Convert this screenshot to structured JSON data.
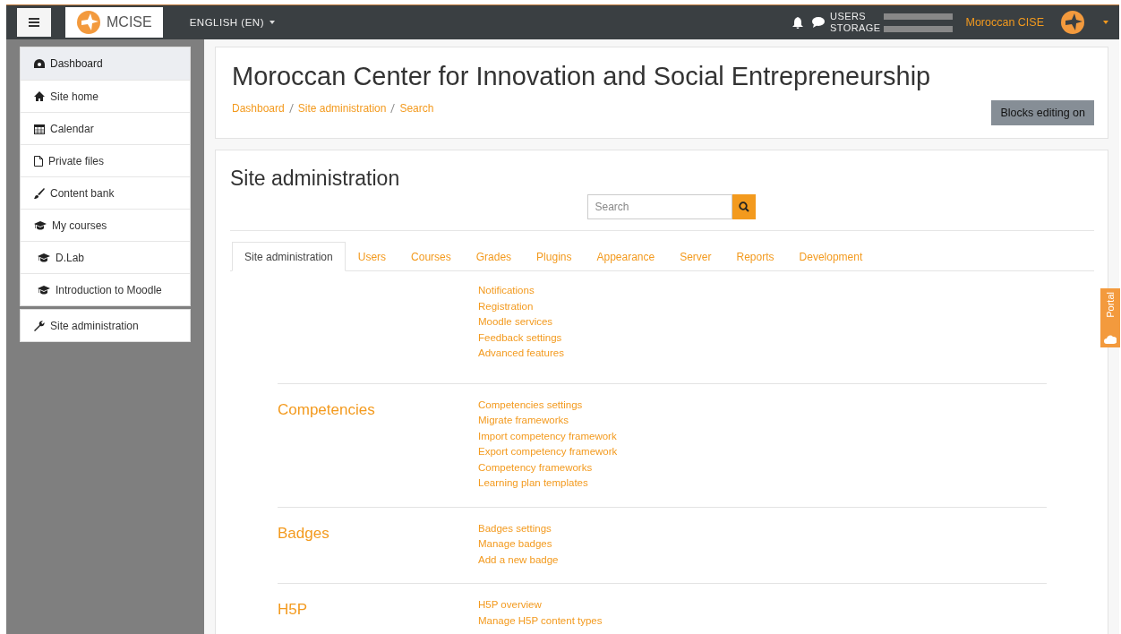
{
  "navbar": {
    "brand": "MCISE",
    "language": "ENGLISH (EN)",
    "usage_labels": [
      "USERS",
      "STORAGE"
    ],
    "user_name": "Moroccan CISE"
  },
  "sidebar": {
    "items": [
      {
        "label": "Dashboard",
        "kind": "dashboard",
        "selected": true,
        "nested": false
      },
      {
        "label": "Site home",
        "kind": "home",
        "selected": false,
        "nested": false
      },
      {
        "label": "Calendar",
        "kind": "calendar",
        "selected": false,
        "nested": false
      },
      {
        "label": "Private files",
        "kind": "file",
        "selected": false,
        "nested": false
      },
      {
        "label": "Content bank",
        "kind": "bank",
        "selected": false,
        "nested": false
      },
      {
        "label": "My courses",
        "kind": "courses",
        "selected": false,
        "nested": false
      },
      {
        "label": "D.Lab",
        "kind": "course",
        "selected": false,
        "nested": true
      },
      {
        "label": "Introduction to Moodle",
        "kind": "course",
        "selected": false,
        "nested": true
      }
    ],
    "admin_item": {
      "label": "Site administration"
    }
  },
  "header": {
    "title": "Moroccan Center for Innovation and Social Entrepreneurship",
    "breadcrumb": [
      "Dashboard",
      "Site administration",
      "Search"
    ],
    "edit_button": "Blocks editing on"
  },
  "admin": {
    "title": "Site administration",
    "search_placeholder": "Search",
    "tabs": [
      {
        "label": "Site administration",
        "selected": true
      },
      {
        "label": "Users",
        "selected": false
      },
      {
        "label": "Courses",
        "selected": false
      },
      {
        "label": "Grades",
        "selected": false
      },
      {
        "label": "Plugins",
        "selected": false
      },
      {
        "label": "Appearance",
        "selected": false
      },
      {
        "label": "Server",
        "selected": false
      },
      {
        "label": "Reports",
        "selected": false
      },
      {
        "label": "Development",
        "selected": false
      }
    ],
    "sections": [
      {
        "links": [
          "Notifications",
          "Registration",
          "Moodle services",
          "Feedback settings",
          "Advanced features"
        ]
      },
      {
        "heading": "Competencies",
        "links": [
          "Competencies settings",
          "Migrate frameworks",
          "Import competency framework",
          "Export competency framework",
          "Competency frameworks",
          "Learning plan templates"
        ]
      },
      {
        "heading": "Badges",
        "links": [
          "Badges settings",
          "Manage badges",
          "Add a new badge"
        ]
      },
      {
        "heading": "H5P",
        "links": [
          "H5P overview",
          "Manage H5P content types"
        ]
      }
    ]
  },
  "portal_tab": {
    "label": "Portal"
  }
}
